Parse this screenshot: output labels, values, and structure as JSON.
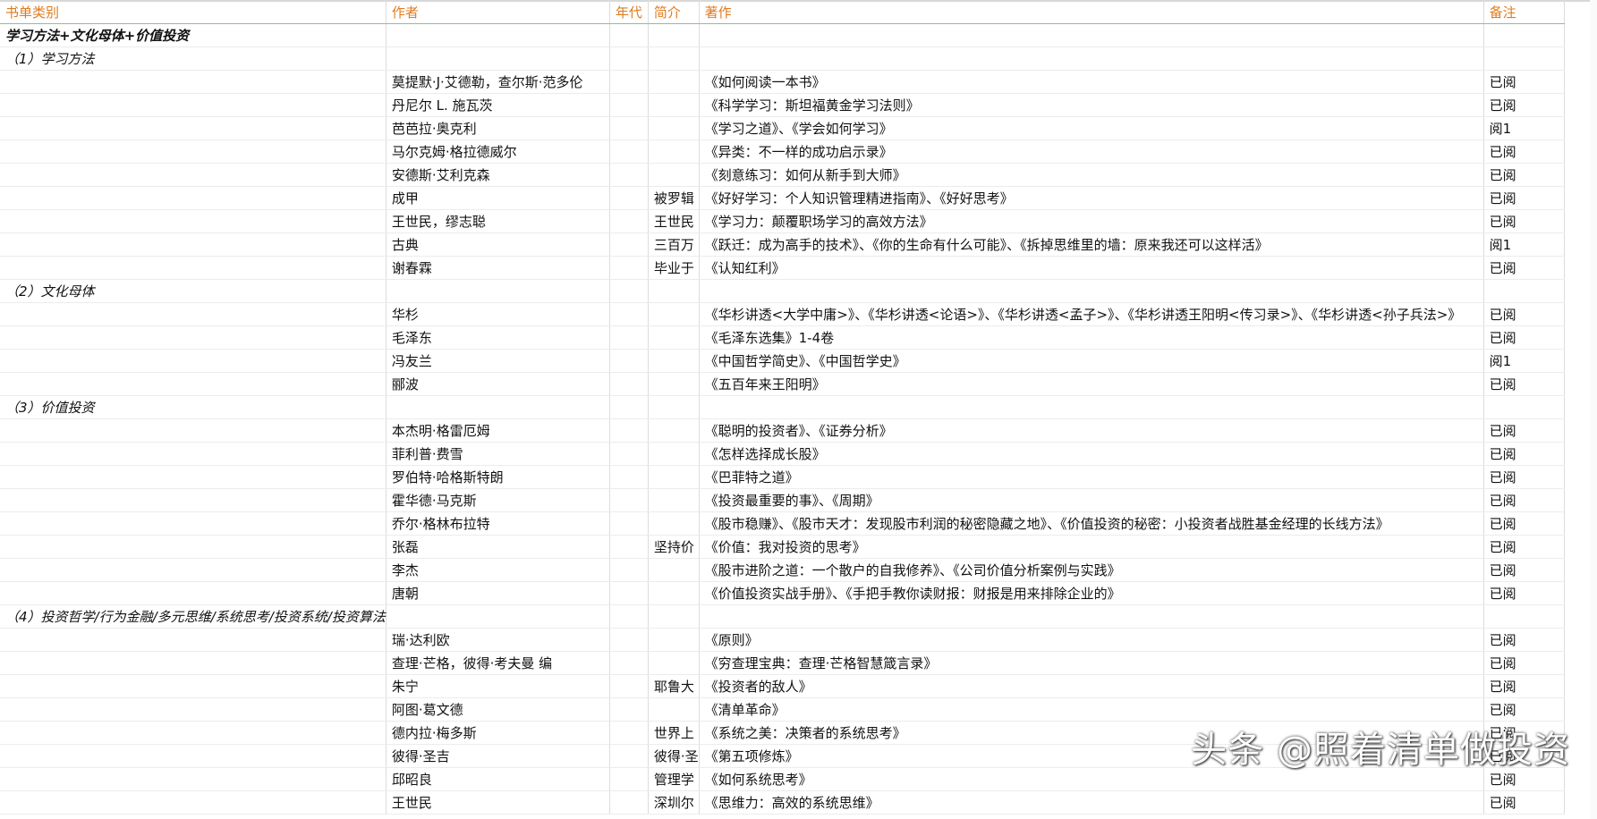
{
  "headers": [
    "书单类别",
    "作者",
    "年代",
    "简介",
    "著作",
    "备注"
  ],
  "rows": [
    [
      "学习方法+文化母体+价值投资",
      "",
      "",
      "",
      "",
      ""
    ],
    [
      "（1）学习方法",
      "",
      "",
      "",
      "",
      ""
    ],
    [
      "",
      "莫提默·J·艾德勒，查尔斯·范多伦",
      "",
      "",
      "《如何阅读一本书》",
      "已阅"
    ],
    [
      "",
      "丹尼尔 L. 施瓦茨",
      "",
      "",
      "《科学学习：斯坦福黄金学习法则》",
      "已阅"
    ],
    [
      "",
      "芭芭拉·奥克利",
      "",
      "",
      "《学习之道》、《学会如何学习》",
      "阅1"
    ],
    [
      "",
      "马尔克姆·格拉德威尔",
      "",
      "",
      "《异类：不一样的成功启示录》",
      "已阅"
    ],
    [
      "",
      "安德斯·艾利克森",
      "",
      "",
      "《刻意练习：如何从新手到大师》",
      "已阅"
    ],
    [
      "",
      "成甲",
      "",
      "被罗辑",
      "《好好学习：个人知识管理精进指南》、《好好思考》",
      "已阅"
    ],
    [
      "",
      "王世民，缪志聪",
      "",
      "王世民",
      "《学习力：颠覆职场学习的高效方法》",
      "已阅"
    ],
    [
      "",
      "古典",
      "",
      "三百万",
      "《跃迁：成为高手的技术》、《你的生命有什么可能》、《拆掉思维里的墙：原来我还可以这样活》",
      "阅1"
    ],
    [
      "",
      "谢春霖",
      "",
      "毕业于",
      "《认知红利》",
      "已阅"
    ],
    [
      "（2）文化母体",
      "",
      "",
      "",
      "",
      ""
    ],
    [
      "",
      "华杉",
      "",
      "",
      "《华杉讲透<大学中庸>》、《华杉讲透<论语>》、《华杉讲透<孟子>》、《华杉讲透王阳明<传习录>》、《华杉讲透<孙子兵法>》",
      "已阅"
    ],
    [
      "",
      "毛泽东",
      "",
      "",
      "《毛泽东选集》1-4卷",
      "已阅"
    ],
    [
      "",
      "冯友兰",
      "",
      "",
      "《中国哲学简史》、《中国哲学史》",
      "阅1"
    ],
    [
      "",
      "郦波",
      "",
      "",
      "《五百年来王阳明》",
      "已阅"
    ],
    [
      "（3）价值投资",
      "",
      "",
      "",
      "",
      ""
    ],
    [
      "",
      "本杰明·格雷厄姆",
      "",
      "",
      "《聪明的投资者》、《证券分析》",
      "已阅"
    ],
    [
      "",
      "菲利普·费雪",
      "",
      "",
      "《怎样选择成长股》",
      "已阅"
    ],
    [
      "",
      "罗伯特·哈格斯特朗",
      "",
      "",
      "《巴菲特之道》",
      "已阅"
    ],
    [
      "",
      "霍华德·马克斯",
      "",
      "",
      "《投资最重要的事》、《周期》",
      "已阅"
    ],
    [
      "",
      "乔尔·格林布拉特",
      "",
      "",
      "《股市稳赚》、《股市天才：发现股市利润的秘密隐藏之地》、《价值投资的秘密：小投资者战胜基金经理的长线方法》",
      "已阅"
    ],
    [
      "",
      "张磊",
      "",
      "坚持价",
      "《价值：我对投资的思考》",
      "已阅"
    ],
    [
      "",
      "李杰",
      "",
      "",
      "《股市进阶之道：一个散户的自我修养》、《公司价值分析案例与实践》",
      "已阅"
    ],
    [
      "",
      "唐朝",
      "",
      "",
      "《价值投资实战手册》、《手把手教你读财报：财报是用来排除企业的》",
      "已阅"
    ],
    [
      "（4）投资哲学/行为金融/多元思维/系统思考/投资系统/投资算法",
      "",
      "",
      "",
      "",
      ""
    ],
    [
      "",
      "瑞·达利欧",
      "",
      "",
      "《原则》",
      "已阅"
    ],
    [
      "",
      "查理·芒格，彼得·考夫曼 编",
      "",
      "",
      "《穷查理宝典：查理·芒格智慧箴言录》",
      "已阅"
    ],
    [
      "",
      "朱宁",
      "",
      "耶鲁大",
      "《投资者的敌人》",
      "已阅"
    ],
    [
      "",
      "阿图·葛文德",
      "",
      "",
      "《清单革命》",
      "已阅"
    ],
    [
      "",
      "德内拉·梅多斯",
      "",
      "世界上",
      "《系统之美：决策者的系统思考》",
      "已阅"
    ],
    [
      "",
      "彼得·圣吉",
      "",
      "彼得·圣",
      "《第五项修炼》",
      "已阅"
    ],
    [
      "",
      "邱昭良",
      "",
      "管理学",
      "《如何系统思考》",
      "已阅"
    ],
    [
      "",
      "王世民",
      "",
      "深圳尔",
      "《思维力：高效的系统思维》",
      "已阅"
    ]
  ],
  "watermark": "头条 @照着清单做投资"
}
